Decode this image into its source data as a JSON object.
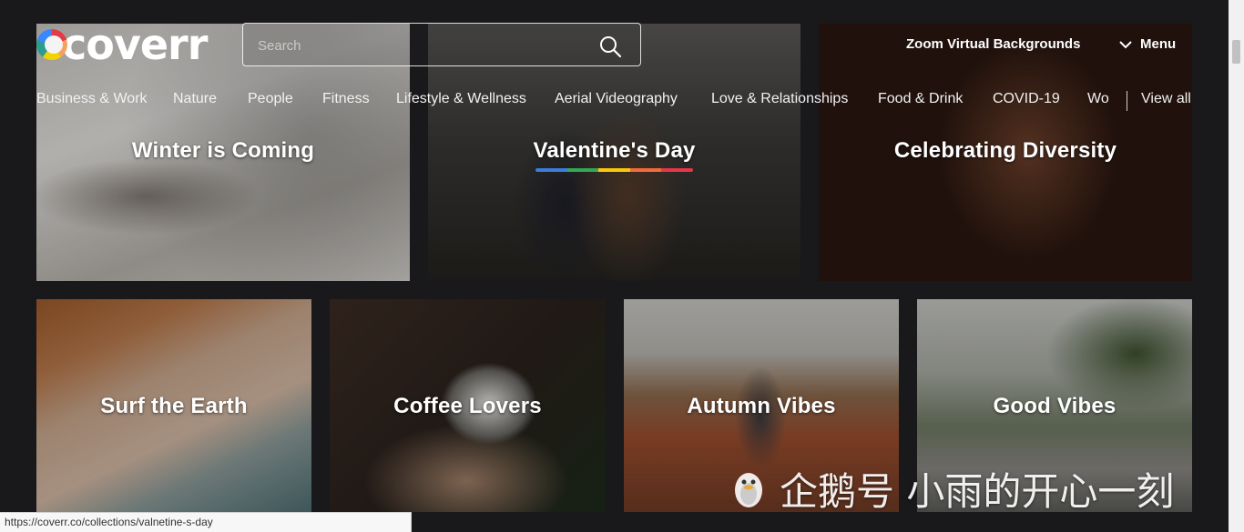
{
  "header": {
    "logo_text": "coverr",
    "search_placeholder": "Search",
    "zoom_link": "Zoom Virtual Backgrounds",
    "menu_label": "Menu"
  },
  "categories": [
    "Business & Work",
    "Nature",
    "People",
    "Fitness",
    "Lifestyle & Wellness",
    "Aerial Videography",
    "Love & Relationships",
    "Food & Drink",
    "COVID-19",
    "Wo"
  ],
  "view_all": "View all",
  "collections_row1": [
    {
      "title": "Winter is Coming"
    },
    {
      "title": "Valentine's Day"
    },
    {
      "title": "Celebrating Diversity"
    }
  ],
  "collections_row2": [
    {
      "title": "Surf the Earth"
    },
    {
      "title": "Coffee Lovers"
    },
    {
      "title": "Autumn Vibes"
    },
    {
      "title": "Good Vibes"
    }
  ],
  "underline_colors": [
    "#3b7dd8",
    "#34a853",
    "#f9c80e",
    "#f26b38",
    "#e6364b"
  ],
  "status_url": "https://coverr.co/collections/valnetine-s-day",
  "watermark_text": "企鹅号 小雨的开心一刻"
}
